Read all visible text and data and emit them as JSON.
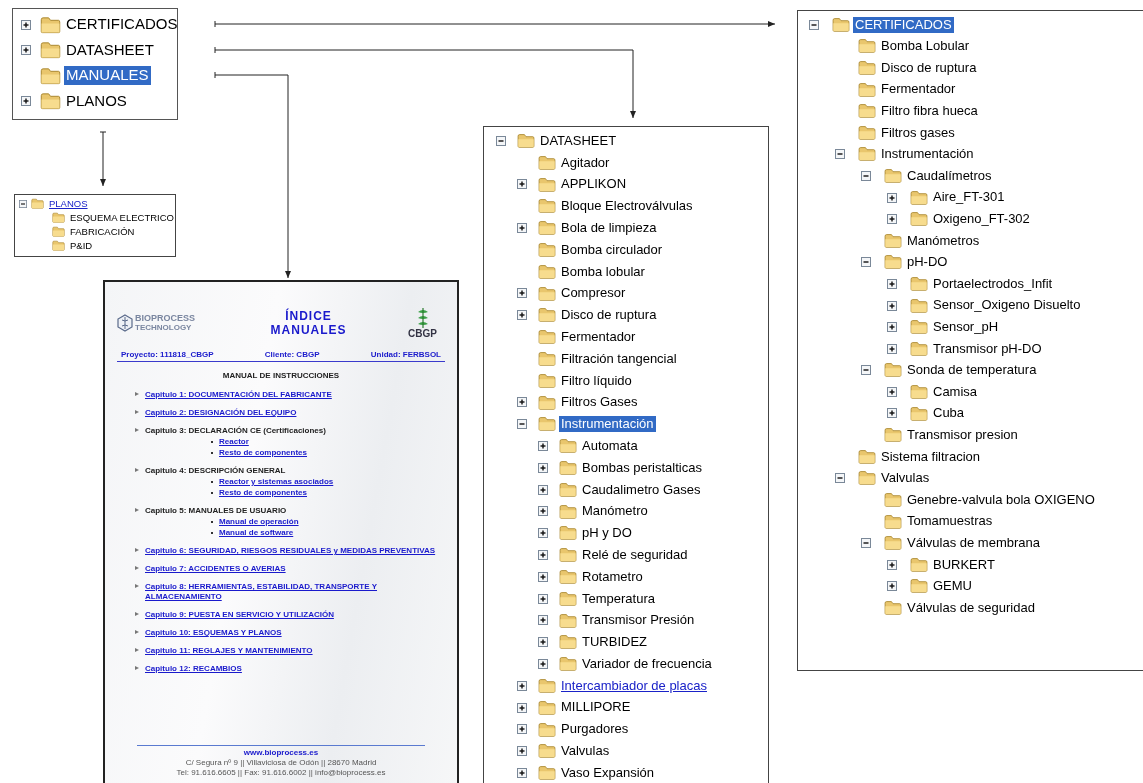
{
  "root_tree": {
    "items": [
      {
        "label": "CERTIFICADOS",
        "expanded": false,
        "selected": false,
        "link": false
      },
      {
        "label": "DATASHEET",
        "expanded": false,
        "selected": false,
        "link": false
      },
      {
        "label": "MANUALES",
        "selected": true,
        "link": false
      },
      {
        "label": "PLANOS",
        "expanded": false,
        "selected": false,
        "link": false
      }
    ]
  },
  "planos_tree": {
    "items": [
      {
        "label": "PLANOS",
        "expanded": true,
        "selected": false,
        "link": true,
        "children": [
          {
            "label": "ESQUEMA ELECTRICO",
            "selected": false,
            "link": false
          },
          {
            "label": "FABRICACIÓN",
            "selected": false,
            "link": false
          },
          {
            "label": "P&ID",
            "selected": false,
            "link": false
          }
        ]
      }
    ]
  },
  "manual_index": {
    "logo_text": [
      "BIOPROCESS",
      "TECHNOLOGY"
    ],
    "title_lines": [
      "ÍNDICE",
      "MANUALES"
    ],
    "partner_logo_text": "CBGP",
    "meta": [
      "Proyecto: 111818_CBGP",
      "Cliente: CBGP",
      "Unidad: FERBSOL"
    ],
    "heading": "MANUAL DE INSTRUCCIONES",
    "chapters": [
      {
        "text": "Capitulo 1: DOCUMENTACIÓN DEL FABRICANTE",
        "link": true
      },
      {
        "text": "Capitulo 2: DESIGNACIÓN DEL EQUIPO",
        "link": true
      },
      {
        "text": "Capitulo 3: DECLARACIÓN CE (Certificaciones)",
        "link": false,
        "subitems": [
          {
            "text": "Reactor",
            "link": true
          },
          {
            "text": "Resto de componentes",
            "link": true
          }
        ]
      },
      {
        "text": "Capitulo 4: DESCRIPCIÓN GENERAL",
        "link": false,
        "subitems": [
          {
            "text": "Reactor y sistemas asociados",
            "link": true
          },
          {
            "text": "Resto de componentes",
            "link": true
          }
        ]
      },
      {
        "text": "Capitulo 5: MANUALES DE USUARIO",
        "link": false,
        "subitems": [
          {
            "text": "Manual de operación",
            "link": true
          },
          {
            "text": "Manual de software",
            "link": true
          }
        ]
      },
      {
        "text": "Capitulo 6: SEGURIDAD, RIESGOS RESIDUALES y MEDIDAS PREVENTIVAS",
        "link": true
      },
      {
        "text": "Capitulo 7: ACCIDENTES O AVERIAS",
        "link": true
      },
      {
        "text": "Capitulo 8: HERRAMIENTAS, ESTABILIDAD, TRANSPORTE Y ALMACENAMIENTO",
        "link": true
      },
      {
        "text": "Capitulo 9: PUESTA EN SERVICIO Y UTILIZACIÓN",
        "link": true
      },
      {
        "text": "Capitulo 10: ESQUEMAS Y PLANOS",
        "link": true
      },
      {
        "text": "Capitulo 11: REGLAJES Y MANTENIMIENTO",
        "link": true
      },
      {
        "text": "Capitulo 12: RECAMBIOS",
        "link": true
      }
    ],
    "footer": [
      "www.bioprocess.es",
      "C/ Segura nº 9 || Villaviciosa de Odón || 28670 Madrid",
      "Tel: 91.616.6605 || Fax: 91.616.6002 || info@bioprocess.es"
    ]
  },
  "datasheet_tree": {
    "items": [
      {
        "label": "DATASHEET",
        "expanded": true,
        "selected": false,
        "link": false,
        "children": [
          {
            "label": "Agitador",
            "selected": false,
            "link": false
          },
          {
            "label": "APPLIKON",
            "expanded": false,
            "selected": false,
            "link": false
          },
          {
            "label": "Bloque Electroválvulas",
            "selected": false,
            "link": false
          },
          {
            "label": "Bola de limpieza",
            "expanded": false,
            "selected": false,
            "link": false
          },
          {
            "label": "Bomba circulador",
            "selected": false,
            "link": false
          },
          {
            "label": "Bomba lobular",
            "selected": false,
            "link": false
          },
          {
            "label": "Compresor",
            "expanded": false,
            "selected": false,
            "link": false
          },
          {
            "label": "Disco de ruptura",
            "expanded": false,
            "selected": false,
            "link": false
          },
          {
            "label": "Fermentador",
            "selected": false,
            "link": false
          },
          {
            "label": "Filtración tangencial",
            "selected": false,
            "link": false
          },
          {
            "label": "Filtro líquido",
            "selected": false,
            "link": false
          },
          {
            "label": "Filtros Gases",
            "expanded": false,
            "selected": false,
            "link": false
          },
          {
            "label": "Instrumentación",
            "expanded": true,
            "selected": true,
            "link": false,
            "children": [
              {
                "label": "Automata",
                "expanded": false,
                "selected": false,
                "link": false
              },
              {
                "label": "Bombas peristalticas",
                "expanded": false,
                "selected": false,
                "link": false
              },
              {
                "label": "Caudalimetro Gases",
                "expanded": false,
                "selected": false,
                "link": false
              },
              {
                "label": "Manómetro",
                "expanded": false,
                "selected": false,
                "link": false
              },
              {
                "label": "pH y DO",
                "expanded": false,
                "selected": false,
                "link": false
              },
              {
                "label": "Relé de seguridad",
                "expanded": false,
                "selected": false,
                "link": false
              },
              {
                "label": "Rotametro",
                "expanded": false,
                "selected": false,
                "link": false
              },
              {
                "label": "Temperatura",
                "expanded": false,
                "selected": false,
                "link": false
              },
              {
                "label": "Transmisor Presión",
                "expanded": false,
                "selected": false,
                "link": false
              },
              {
                "label": "TURBIDEZ",
                "expanded": false,
                "selected": false,
                "link": false
              },
              {
                "label": "Variador de frecuencia",
                "expanded": false,
                "selected": false,
                "link": false
              }
            ]
          },
          {
            "label": "Intercambiador de placas",
            "expanded": false,
            "selected": false,
            "link": true
          },
          {
            "label": "MILLIPORE",
            "expanded": false,
            "selected": false,
            "link": false
          },
          {
            "label": "Purgadores",
            "expanded": false,
            "selected": false,
            "link": false
          },
          {
            "label": "Valvulas",
            "expanded": false,
            "selected": false,
            "link": false
          },
          {
            "label": "Vaso Expansión",
            "expanded": false,
            "selected": false,
            "link": false
          }
        ]
      }
    ]
  },
  "certificados_tree": {
    "items": [
      {
        "label": "CERTIFICADOS",
        "expanded": true,
        "selected": true,
        "link": false,
        "children": [
          {
            "label": "Bomba Lobular",
            "selected": false,
            "link": false
          },
          {
            "label": "Disco de ruptura",
            "selected": false,
            "link": false
          },
          {
            "label": "Fermentador",
            "selected": false,
            "link": false
          },
          {
            "label": "Filtro fibra hueca",
            "selected": false,
            "link": false
          },
          {
            "label": "Filtros gases",
            "selected": false,
            "link": false
          },
          {
            "label": "Instrumentación",
            "expanded": true,
            "selected": false,
            "link": false,
            "children": [
              {
                "label": "Caudalímetros",
                "expanded": true,
                "selected": false,
                "link": false,
                "children": [
                  {
                    "label": "Aire_FT-301",
                    "expanded": false,
                    "selected": false,
                    "link": false
                  },
                  {
                    "label": "Oxigeno_FT-302",
                    "expanded": false,
                    "selected": false,
                    "link": false
                  }
                ]
              },
              {
                "label": "Manómetros",
                "selected": false,
                "link": false
              },
              {
                "label": "pH-DO",
                "expanded": true,
                "selected": false,
                "link": false,
                "children": [
                  {
                    "label": "Portaelectrodos_Infit",
                    "expanded": false,
                    "selected": false,
                    "link": false
                  },
                  {
                    "label": "Sensor_Oxigeno Disuelto",
                    "expanded": false,
                    "selected": false,
                    "link": false
                  },
                  {
                    "label": "Sensor_pH",
                    "expanded": false,
                    "selected": false,
                    "link": false
                  },
                  {
                    "label": "Transmisor pH-DO",
                    "expanded": false,
                    "selected": false,
                    "link": false
                  }
                ]
              },
              {
                "label": "Sonda de temperatura",
                "expanded": true,
                "selected": false,
                "link": false,
                "children": [
                  {
                    "label": "Camisa",
                    "expanded": false,
                    "selected": false,
                    "link": false
                  },
                  {
                    "label": "Cuba",
                    "expanded": false,
                    "selected": false,
                    "link": false
                  }
                ]
              },
              {
                "label": "Transmisor presion",
                "selected": false,
                "link": false
              }
            ]
          },
          {
            "label": "Sistema filtracion",
            "selected": false,
            "link": false
          },
          {
            "label": "Valvulas",
            "expanded": true,
            "selected": false,
            "link": false,
            "children": [
              {
                "label": "Genebre-valvula bola OXIGENO",
                "selected": false,
                "link": false
              },
              {
                "label": "Tomamuestras",
                "selected": false,
                "link": false
              },
              {
                "label": "Válvulas de membrana",
                "expanded": true,
                "selected": false,
                "link": false,
                "children": [
                  {
                    "label": "BURKERT",
                    "expanded": false,
                    "selected": false,
                    "link": false
                  },
                  {
                    "label": "GEMU",
                    "expanded": false,
                    "selected": false,
                    "link": false
                  }
                ]
              },
              {
                "label": "Válvulas de seguridad",
                "selected": false,
                "link": false
              }
            ]
          }
        ]
      }
    ]
  }
}
